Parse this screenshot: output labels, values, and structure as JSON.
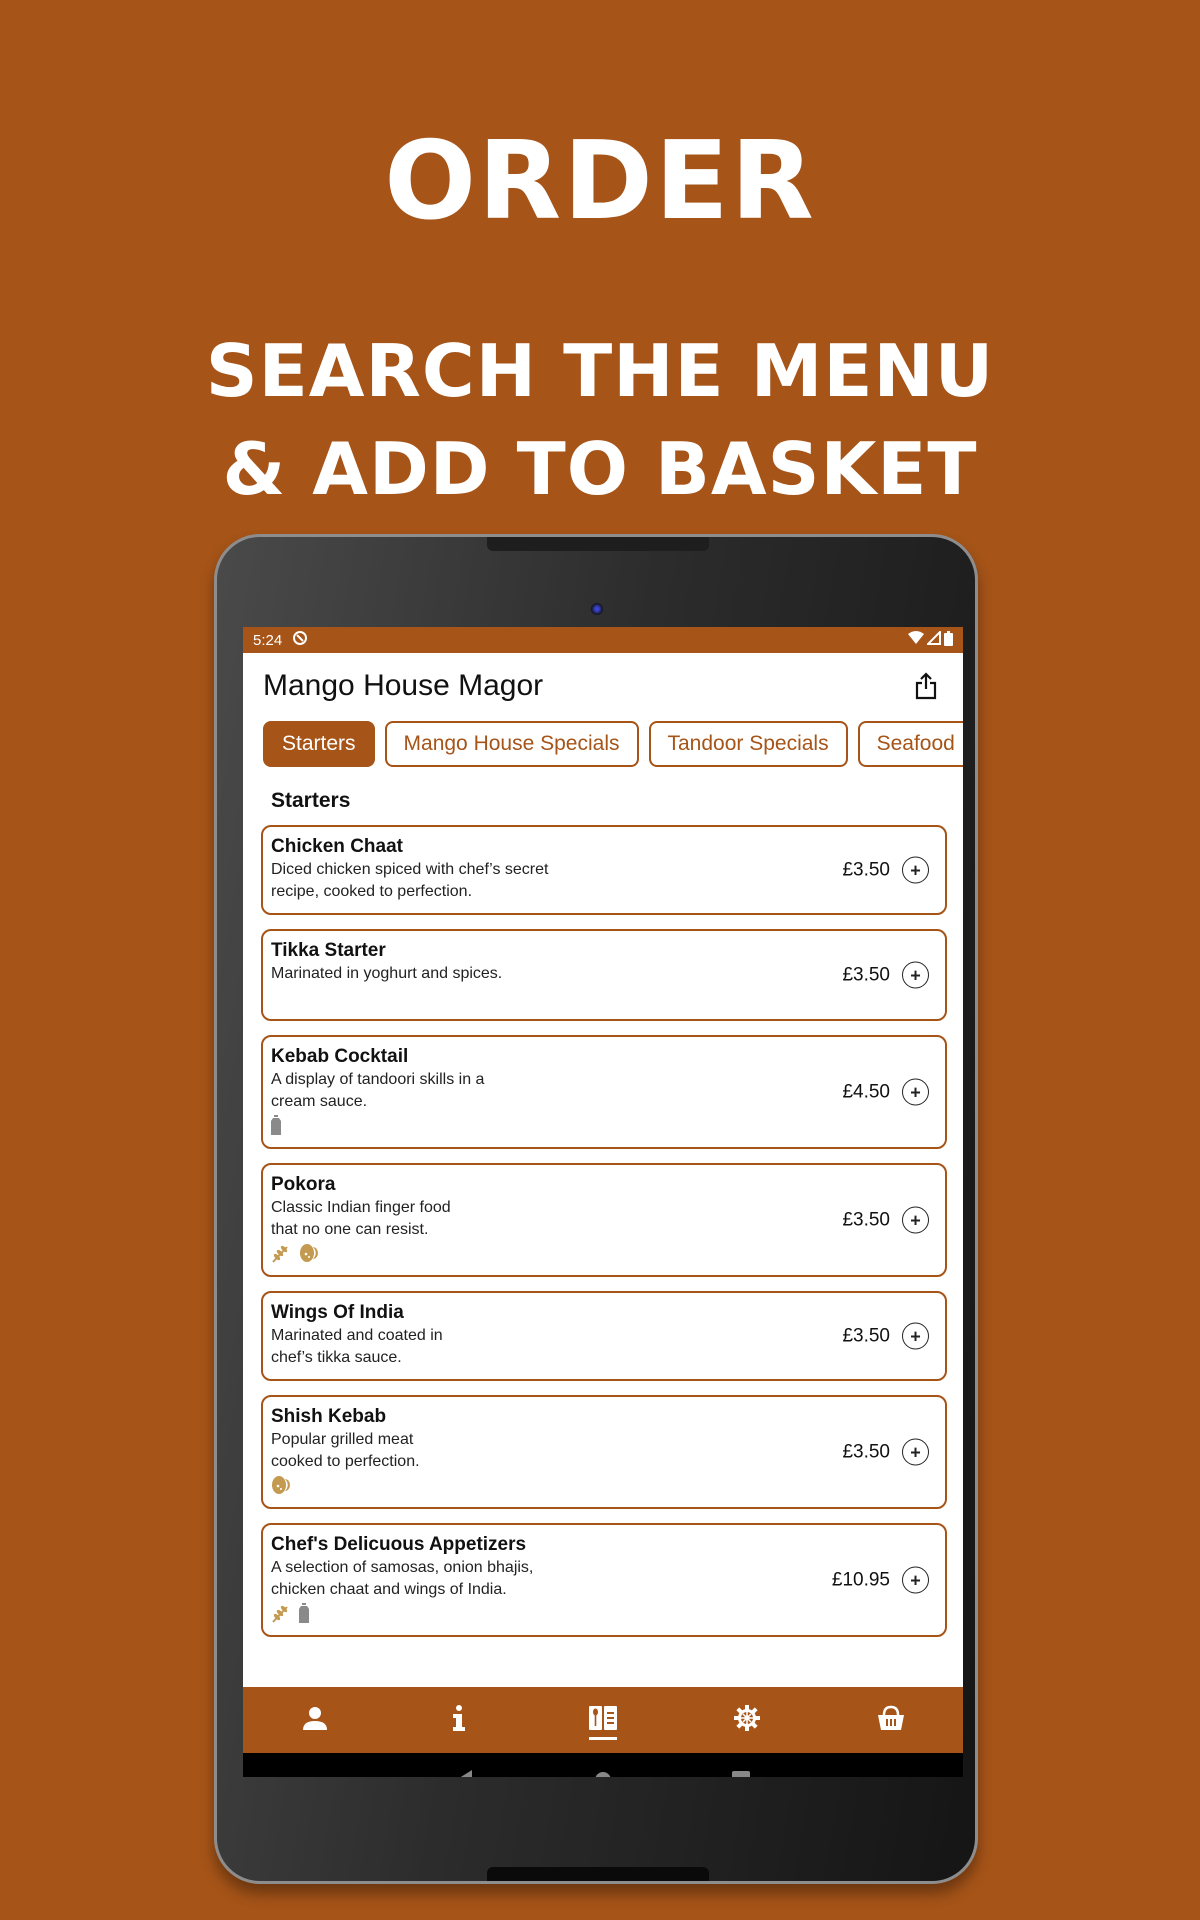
{
  "hero": {
    "title": "ORDER",
    "subtitle_line1": "SEARCH THE MENU",
    "subtitle_line2": "& ADD TO BASKET"
  },
  "status_bar": {
    "time": "5:24",
    "icons": [
      "sync-icon",
      "wifi-icon",
      "signal-icon",
      "battery-icon"
    ]
  },
  "app_bar": {
    "title": "Mango House Magor",
    "share_icon": "share-icon"
  },
  "tabs": [
    {
      "label": "Starters",
      "active": true
    },
    {
      "label": "Mango House Specials",
      "active": false
    },
    {
      "label": "Tandoor Specials",
      "active": false
    },
    {
      "label": "Seafood",
      "active": false
    }
  ],
  "section": {
    "title": "Starters"
  },
  "items": [
    {
      "name": "Chicken Chaat",
      "desc": "Diced chicken spiced with chef’s secret recipe, cooked to perfection.",
      "price": "£3.50",
      "allergens": []
    },
    {
      "name": "Tikka Starter",
      "desc": "Marinated in yoghurt and spices.",
      "price": "£3.50",
      "allergens": []
    },
    {
      "name": "Kebab Cocktail",
      "desc": "A display of tandoori skills in a cream sauce.",
      "price": "£4.50",
      "allergens": [
        "milk-icon"
      ]
    },
    {
      "name": "Pokora",
      "desc": "Classic Indian finger food that no one can resist.",
      "price": "£3.50",
      "allergens": [
        "gluten-icon",
        "egg-icon"
      ]
    },
    {
      "name": "Wings Of India",
      "desc": "Marinated and coated in chef’s tikka sauce.",
      "price": "£3.50",
      "allergens": []
    },
    {
      "name": "Shish Kebab",
      "desc": "Popular grilled meat cooked to perfection.",
      "price": "£3.50",
      "allergens": [
        "egg-icon"
      ]
    },
    {
      "name": "Chef's Delicuous Appetizers",
      "desc": "A selection of samosas, onion bhajis, chicken chaat and wings of India.",
      "price": "£10.95",
      "allergens": [
        "gluten-icon",
        "milk-icon"
      ]
    }
  ],
  "add_button": "+",
  "bottom_nav": [
    {
      "icon": "account-icon",
      "active": false
    },
    {
      "icon": "info-icon",
      "active": false
    },
    {
      "icon": "menu-book-icon",
      "active": true
    },
    {
      "icon": "settings-icon",
      "active": false
    },
    {
      "icon": "basket-icon",
      "active": false
    }
  ],
  "colors": {
    "brand": "#a65418",
    "background": "#a65418",
    "text": "#111111",
    "allergen_gold": "#c39a4f",
    "allergen_grey": "#8a8a8a"
  }
}
